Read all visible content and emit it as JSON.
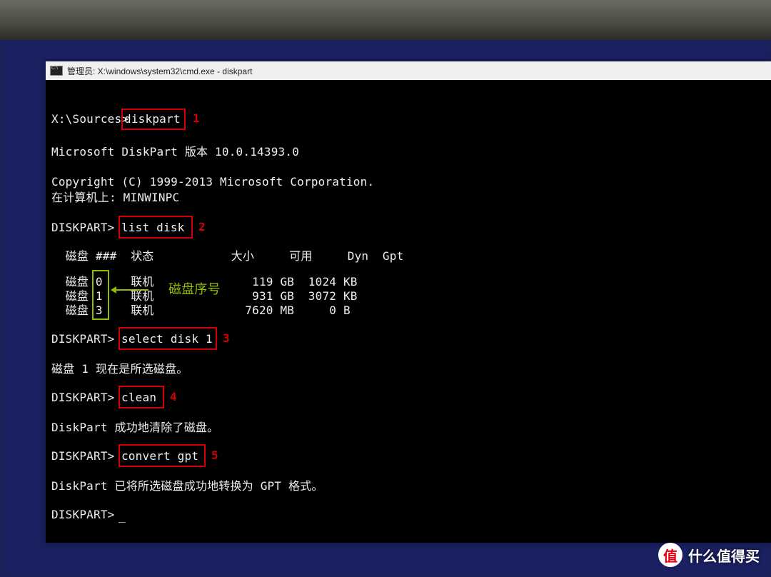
{
  "window": {
    "title": "管理员: X:\\windows\\system32\\cmd.exe - diskpart"
  },
  "terminal": {
    "prompt1_path": "X:\\Sources>",
    "cmd1": "diskpart",
    "version_line": "Microsoft DiskPart 版本 10.0.14393.0",
    "copyright_line": "Copyright (C) 1999-2013 Microsoft Corporation.",
    "computer_line": "在计算机上: MINWINPC",
    "prompt2": "DISKPART> ",
    "cmd2": "list disk",
    "table_header": "  磁盘 ###  状态           大小     可用     Dyn  Gpt",
    "table_row0": "  磁盘 0    联机              119 GB  1024 KB",
    "table_row1": "  磁盘 1    联机              931 GB  3072 KB",
    "table_row2": "  磁盘 3    联机             7620 MB     0 B",
    "cmd3": "select disk 1",
    "result3": "磁盘 1 现在是所选磁盘。",
    "cmd4": "clean",
    "result4": "DiskPart 成功地清除了磁盘。",
    "cmd5": "convert gpt",
    "result5": "DiskPart 已将所选磁盘成功地转换为 GPT 格式。",
    "prompt_end": "DISKPART> ",
    "cursor": "_"
  },
  "annotations": {
    "step1": "1",
    "step2": "2",
    "step3": "3",
    "step4": "4",
    "step5": "5",
    "disk_number_label": "磁盘序号"
  },
  "watermark": {
    "badge_text": "值",
    "site_text": "什么值得买"
  }
}
